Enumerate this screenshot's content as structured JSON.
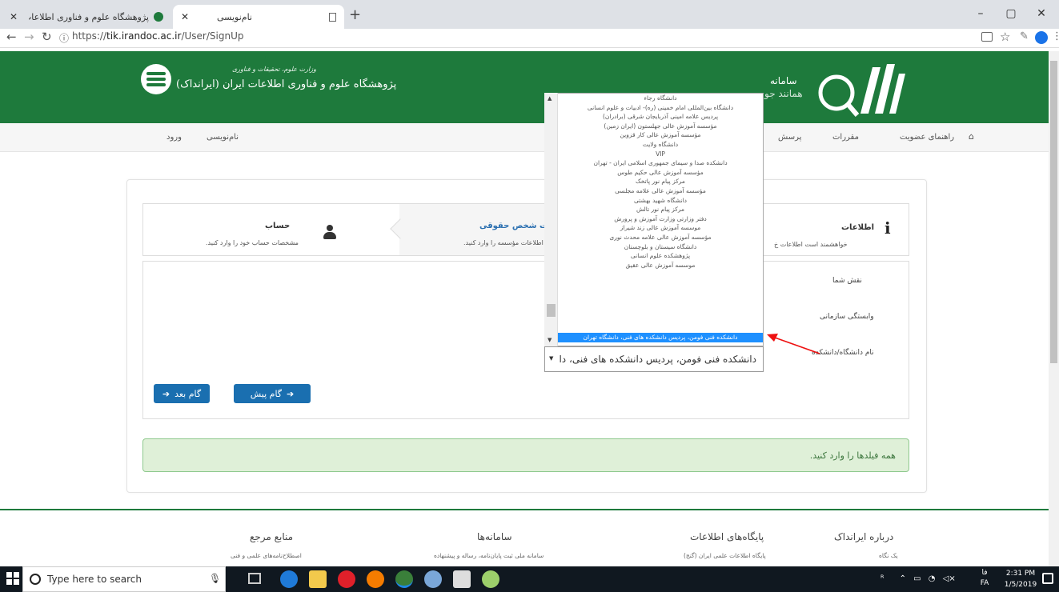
{
  "browser": {
    "tabs": [
      {
        "title": "پژوهشگاه علوم و فناوری اطلاعات ا",
        "close": "✕"
      },
      {
        "title": "نام‌نویسی",
        "close": "✕"
      }
    ],
    "new_tab": "+",
    "url_prefix": "https://",
    "url_host": "tik.irandoc.ac.ir",
    "url_path": "/User/SignUp",
    "window_controls": {
      "minimize": "–",
      "maximize": "▢",
      "close": "✕"
    }
  },
  "header": {
    "ministry": "وزارت علوم، تحقیقات و فناوری",
    "org_name": "پژوهشگاه علوم و فناوری اطلاعات ایران (ایرانداک)",
    "system_title_1": "سامانه",
    "system_title_2": "همانند جو"
  },
  "nav": {
    "home_icon": "home-icon",
    "items": [
      "راهنمای عضویت",
      "مقررات",
      "پرسش"
    ],
    "auth": [
      "نام‌نویسی",
      "ورود"
    ]
  },
  "steps": [
    {
      "title": "اطلاعات",
      "desc": "خواهشمند است اطلاعات خ",
      "icon": "info-icon"
    },
    {
      "title": "اطلاعات شخص حقوقی",
      "desc": "اطلاعات مؤسسه را وارد کنید."
    },
    {
      "title": "حساب",
      "desc": "مشخصات حساب خود را وارد کنید.",
      "icon": "user-icon"
    }
  ],
  "form": {
    "labels": [
      "نقش شما",
      "وابستگی سازمانی",
      "نام دانشگاه/دانشکده"
    ],
    "next_button": "گام بعد",
    "prev_button": "گام پیش"
  },
  "dropdown": {
    "options": [
      "دانشگاه رجاء",
      "دانشگاه بین‌المللی امام خمینی (ره)- ادبیات و علوم انسانی",
      "پردیس علامه امینی آذربایجان شرقی (برادران)",
      "مؤسسه آموزش عالی جهلستون (ایران زمین)",
      "مؤسسه آموزش عالی کار قزوین",
      "دانشگاه ولایت",
      "VIP",
      "دانشکده صدا و سیمای جمهوری اسلامی ایران - تهران",
      "مؤسسه آموزش عالی حکیم طوس",
      "مرکز پیام نور پاتخک",
      "مؤسسه آموزش عالی علامه مجلسی",
      "دانشگاه شهید بهشتی",
      "مرکز پیام نور تالش",
      "دفتر وزارتی وزارت آموزش و پرورش",
      "موسسه آموزش عالی زند شیراز",
      "مؤسسه آموزش عالی علامه محدث نوری",
      "دانشگاه سیستان و بلوچستان",
      "پژوهشکده علوم انسانی",
      "موسسه آموزش عالی عقیق",
      "دانشکده فنی فومن، پردیس دانشکده های فنی، دانشگاه تهران"
    ],
    "selected_index": 19,
    "selected_display": "دانشکده فنی فومن، پردیس دانشکده های فنی، دا"
  },
  "alert": "همه فیلدها را وارد کنید.",
  "footer": {
    "columns": [
      {
        "title": "درباره ایرانداک",
        "sub": "یک نگاه"
      },
      {
        "title": "پایگاه‌های اطلاعات",
        "sub": "پایگاه اطلاعات علمی ایران (گنج)"
      },
      {
        "title": "سامانه‌ها",
        "sub": "سامانه ملی ثبت پایان‌نامه، رساله و پیشنهاده"
      },
      {
        "title": "منابع مرجع",
        "sub": "اصطلاح‌نامه‌های علمی و فنی"
      }
    ]
  },
  "taskbar": {
    "search_placeholder": "Type here to search",
    "time": "2:31 PM",
    "date": "1/5/2019",
    "lang": "FA",
    "lang_top": "فا"
  },
  "colors": {
    "header_green": "#1e7a3c",
    "primary_blue": "#1a6fb0",
    "alert_bg": "#dff0d8",
    "selection": "#1e90ff"
  }
}
